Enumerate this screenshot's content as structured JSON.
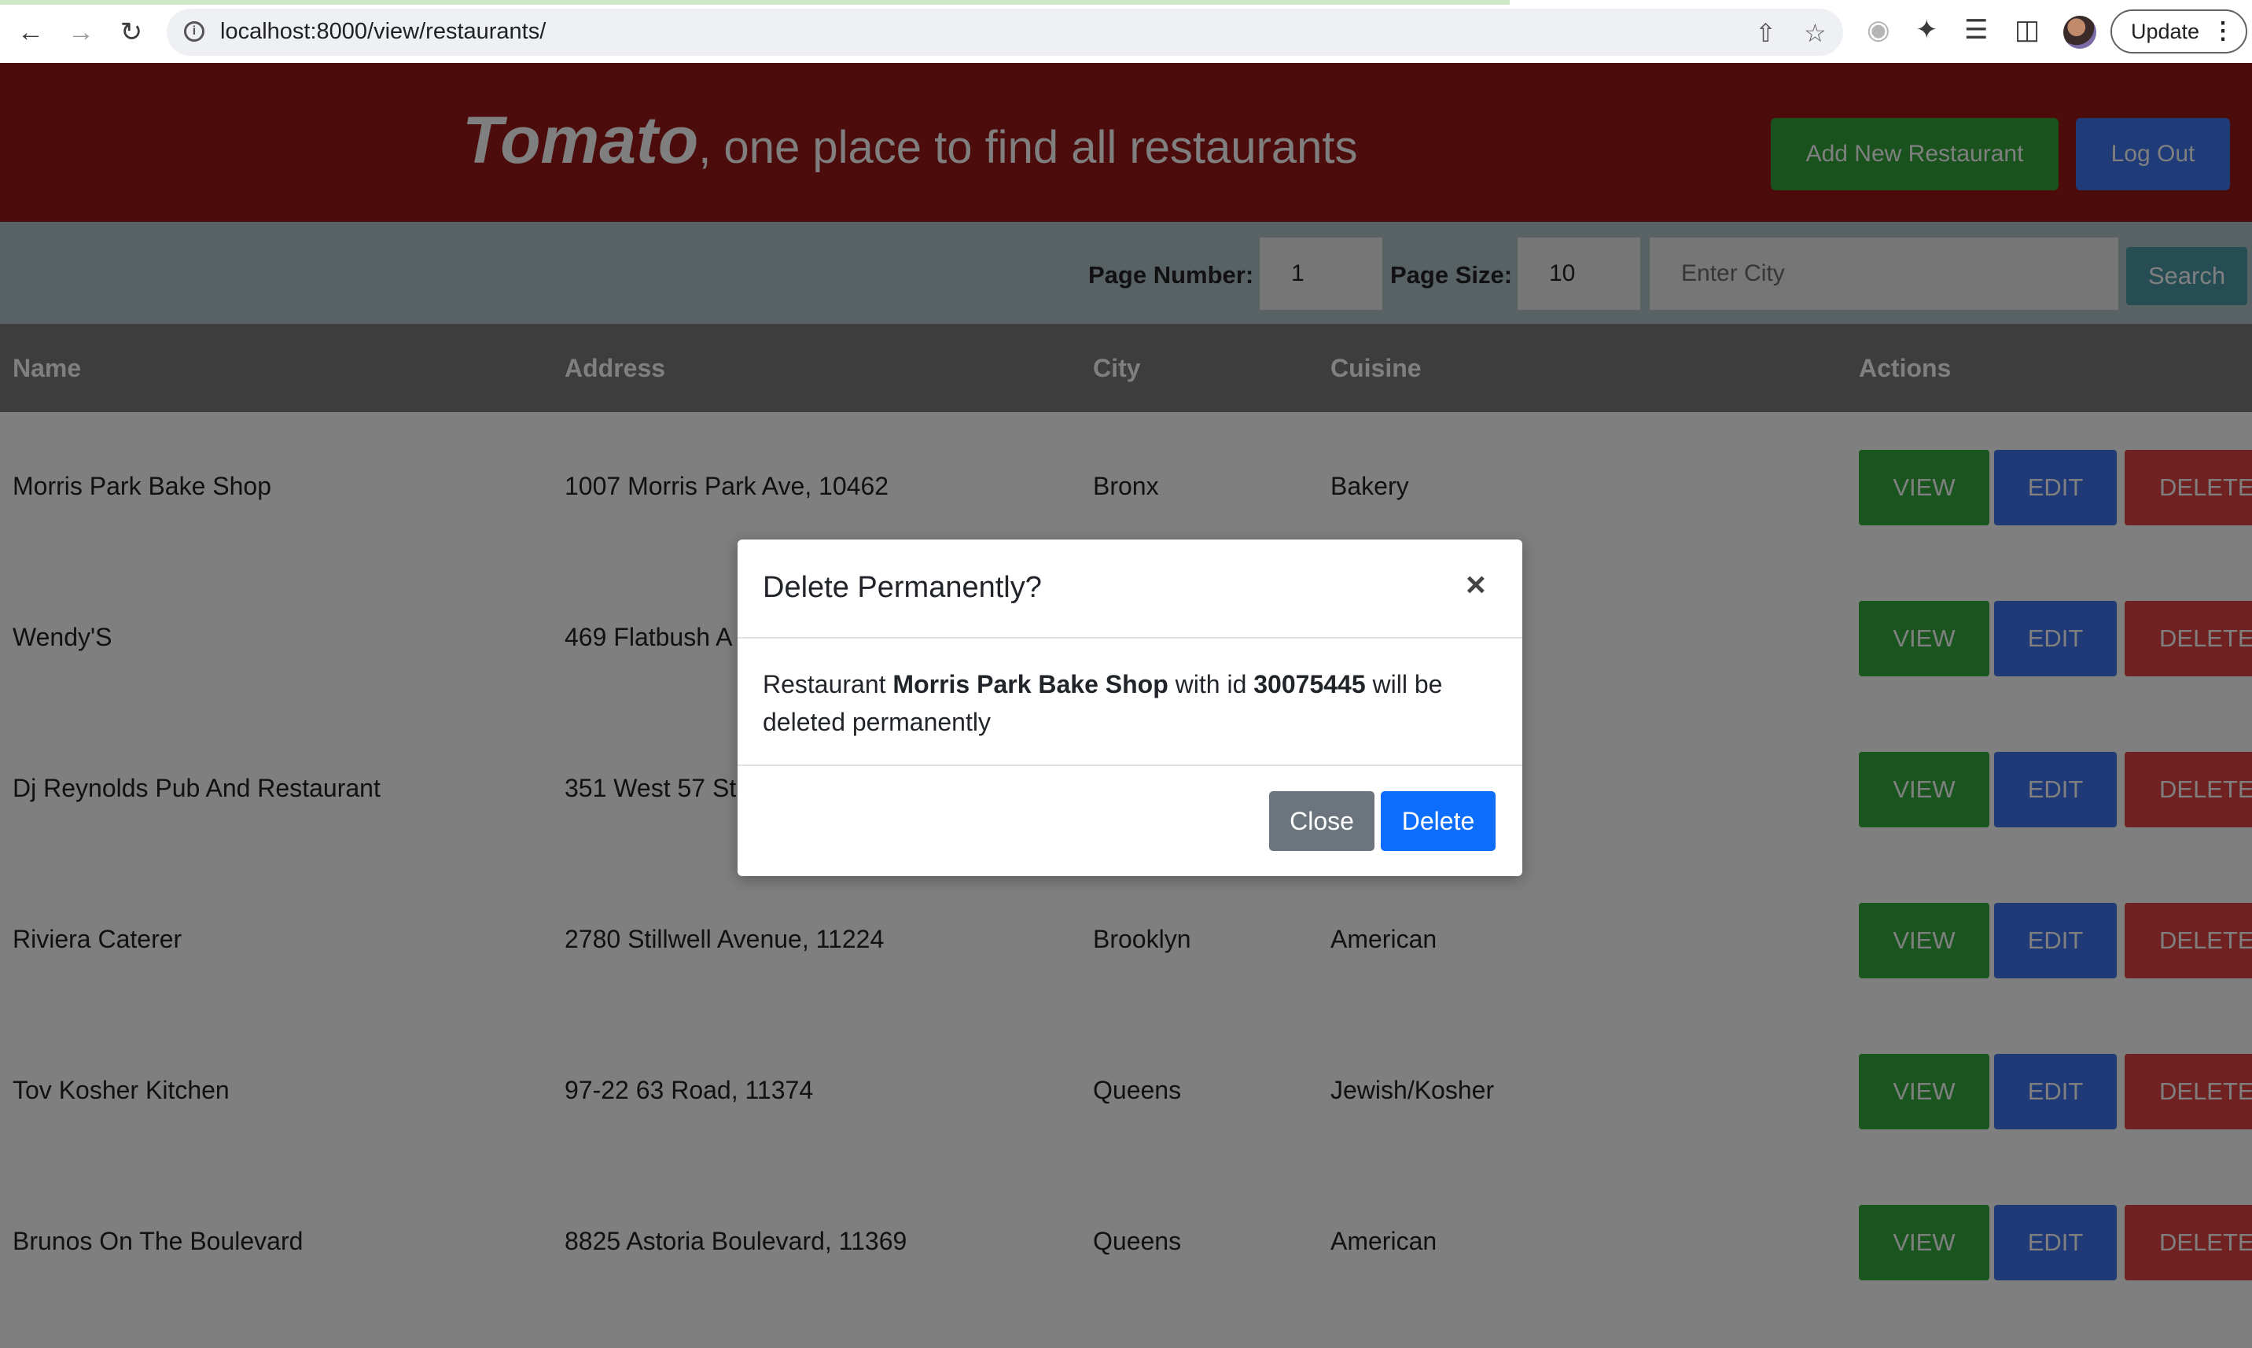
{
  "browser": {
    "url": "localhost:8000/view/restaurants/",
    "update_label": "Update"
  },
  "header": {
    "brand_name": "Tomato",
    "tagline": ", one place to find all restaurants",
    "add_button": "Add New Restaurant",
    "logout_button": "Log Out"
  },
  "search": {
    "page_number_label": "Page Number:",
    "page_number_value": "1",
    "page_size_label": "Page Size:",
    "page_size_value": "10",
    "city_placeholder": "Enter City",
    "search_button": "Search"
  },
  "table": {
    "columns": [
      "Name",
      "Address",
      "City",
      "Cuisine",
      "Actions"
    ],
    "rows": [
      {
        "name": "Morris Park Bake Shop",
        "address": "1007 Morris Park Ave, 10462",
        "city": "Bronx",
        "cuisine": "Bakery"
      },
      {
        "name": "Wendy'S",
        "address": "469 Flatbush A",
        "city": "",
        "cuisine": ""
      },
      {
        "name": "Dj Reynolds Pub And Restaurant",
        "address": "351 West 57 St",
        "city": "",
        "cuisine": ""
      },
      {
        "name": "Riviera Caterer",
        "address": "2780 Stillwell Avenue, 11224",
        "city": "Brooklyn",
        "cuisine": "American"
      },
      {
        "name": "Tov Kosher Kitchen",
        "address": "97-22 63 Road, 11374",
        "city": "Queens",
        "cuisine": "Jewish/Kosher"
      },
      {
        "name": "Brunos On The Boulevard",
        "address": "8825 Astoria Boulevard, 11369",
        "city": "Queens",
        "cuisine": "American"
      }
    ],
    "actions": {
      "view": "VIEW",
      "edit": "EDIT",
      "delete": "DELETE"
    }
  },
  "modal": {
    "title": "Delete Permanently?",
    "close_icon": "×",
    "body_prefix": "Restaurant ",
    "restaurant_name": "Morris Park Bake Shop",
    "body_middle": " with id ",
    "restaurant_id": "30075445",
    "body_suffix": " will be deleted permanently",
    "close_button": "Close",
    "delete_button": "Delete"
  }
}
